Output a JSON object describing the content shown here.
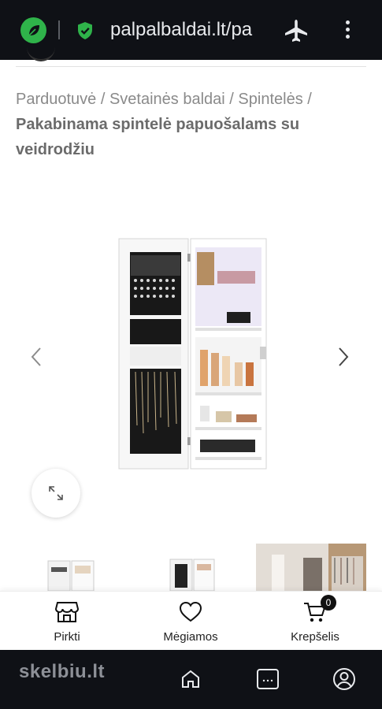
{
  "browser": {
    "url": "palpalbaldai.lt/pa",
    "colors": {
      "bar_bg": "#0f1116",
      "leaf_green": "#2fb34a",
      "shield_green": "#2fb34a"
    }
  },
  "breadcrumb": {
    "items": [
      "Parduotuvė",
      "Svetainės baldai",
      "Spintelės"
    ],
    "separator": " / ",
    "current": "Pakabinama spintelė papuošalams su veidrodžiu"
  },
  "product_image": {
    "description_icon": "jewelry-cabinet-image"
  },
  "bottom_nav": {
    "items": [
      {
        "label": "Pirkti",
        "icon": "store-icon"
      },
      {
        "label": "Mėgiamos",
        "icon": "heart-icon"
      },
      {
        "label": "Krepšelis",
        "icon": "cart-icon",
        "badge": "0"
      }
    ]
  },
  "system_nav": {
    "watermark": "skelbiu.lt",
    "icons": [
      "back-icon",
      "forward-icon",
      "home-icon",
      "tabs-icon",
      "account-icon"
    ]
  }
}
